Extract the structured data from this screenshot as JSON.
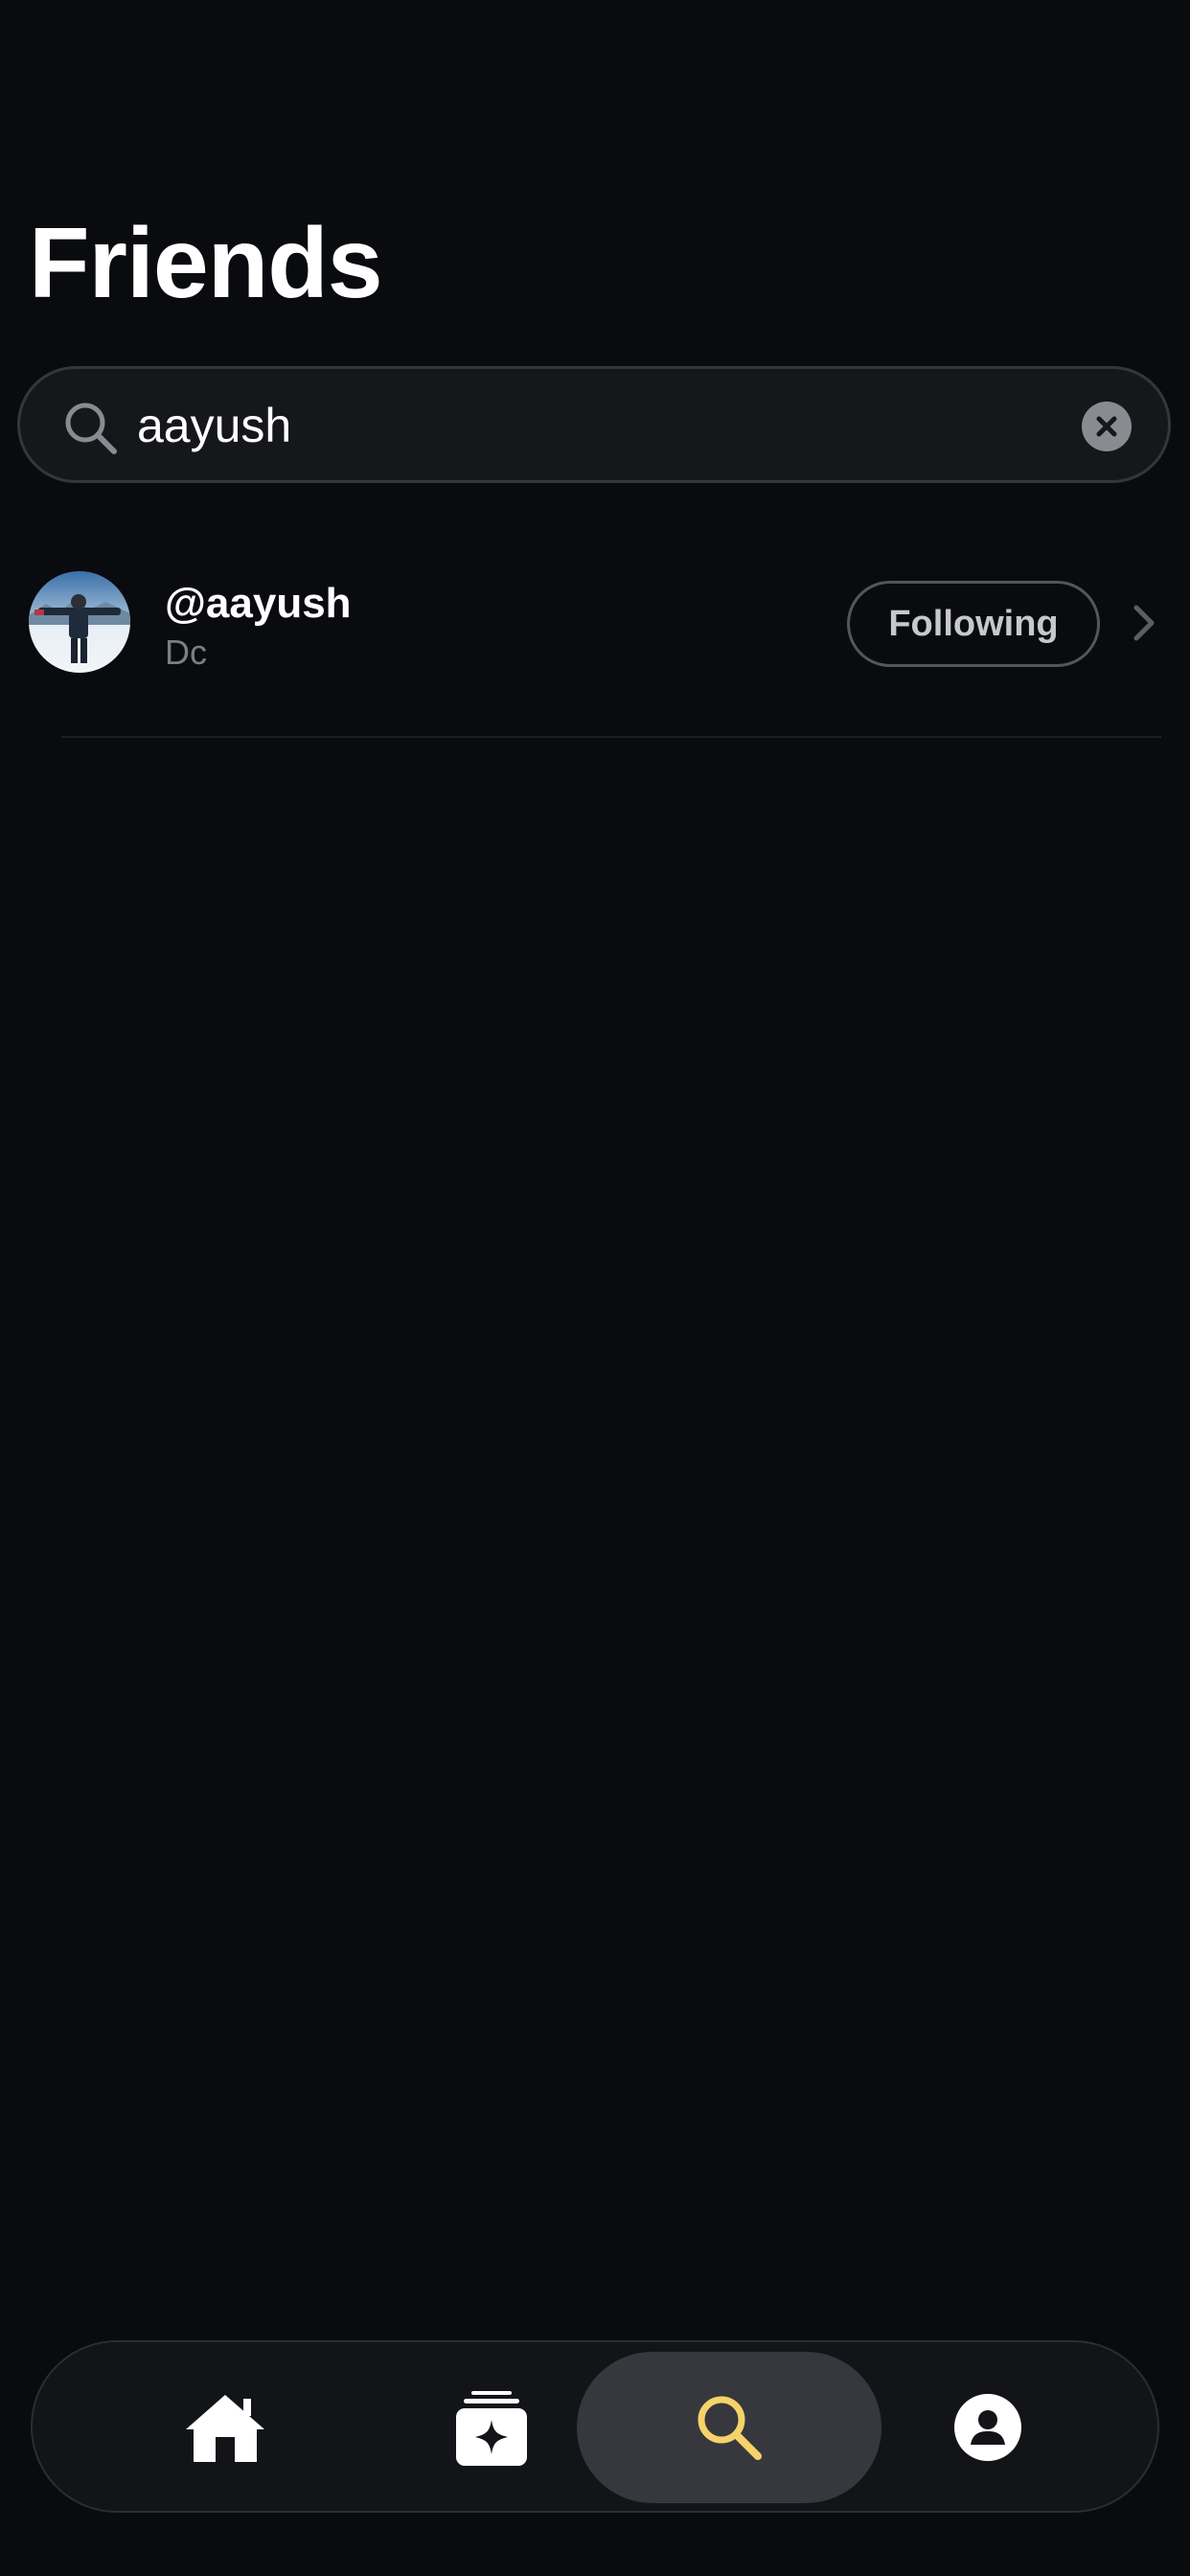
{
  "header": {
    "title": "Friends"
  },
  "search": {
    "value": "aayush",
    "icon": "search-icon",
    "clear_icon": "clear-icon"
  },
  "results": [
    {
      "username": "@aayush",
      "display_name": "Dc",
      "follow_label": "Following",
      "avatar": "avatar-photo"
    }
  ],
  "tab_bar": {
    "items": [
      {
        "icon": "home-icon",
        "active": false
      },
      {
        "icon": "sparkle-stack-icon",
        "active": false
      },
      {
        "icon": "search-icon",
        "active": true
      },
      {
        "icon": "profile-icon",
        "active": false
      }
    ]
  },
  "colors": {
    "background": "#0a0b0f",
    "active_accent": "#f6d26a",
    "secondary_text": "#7d7e83"
  }
}
